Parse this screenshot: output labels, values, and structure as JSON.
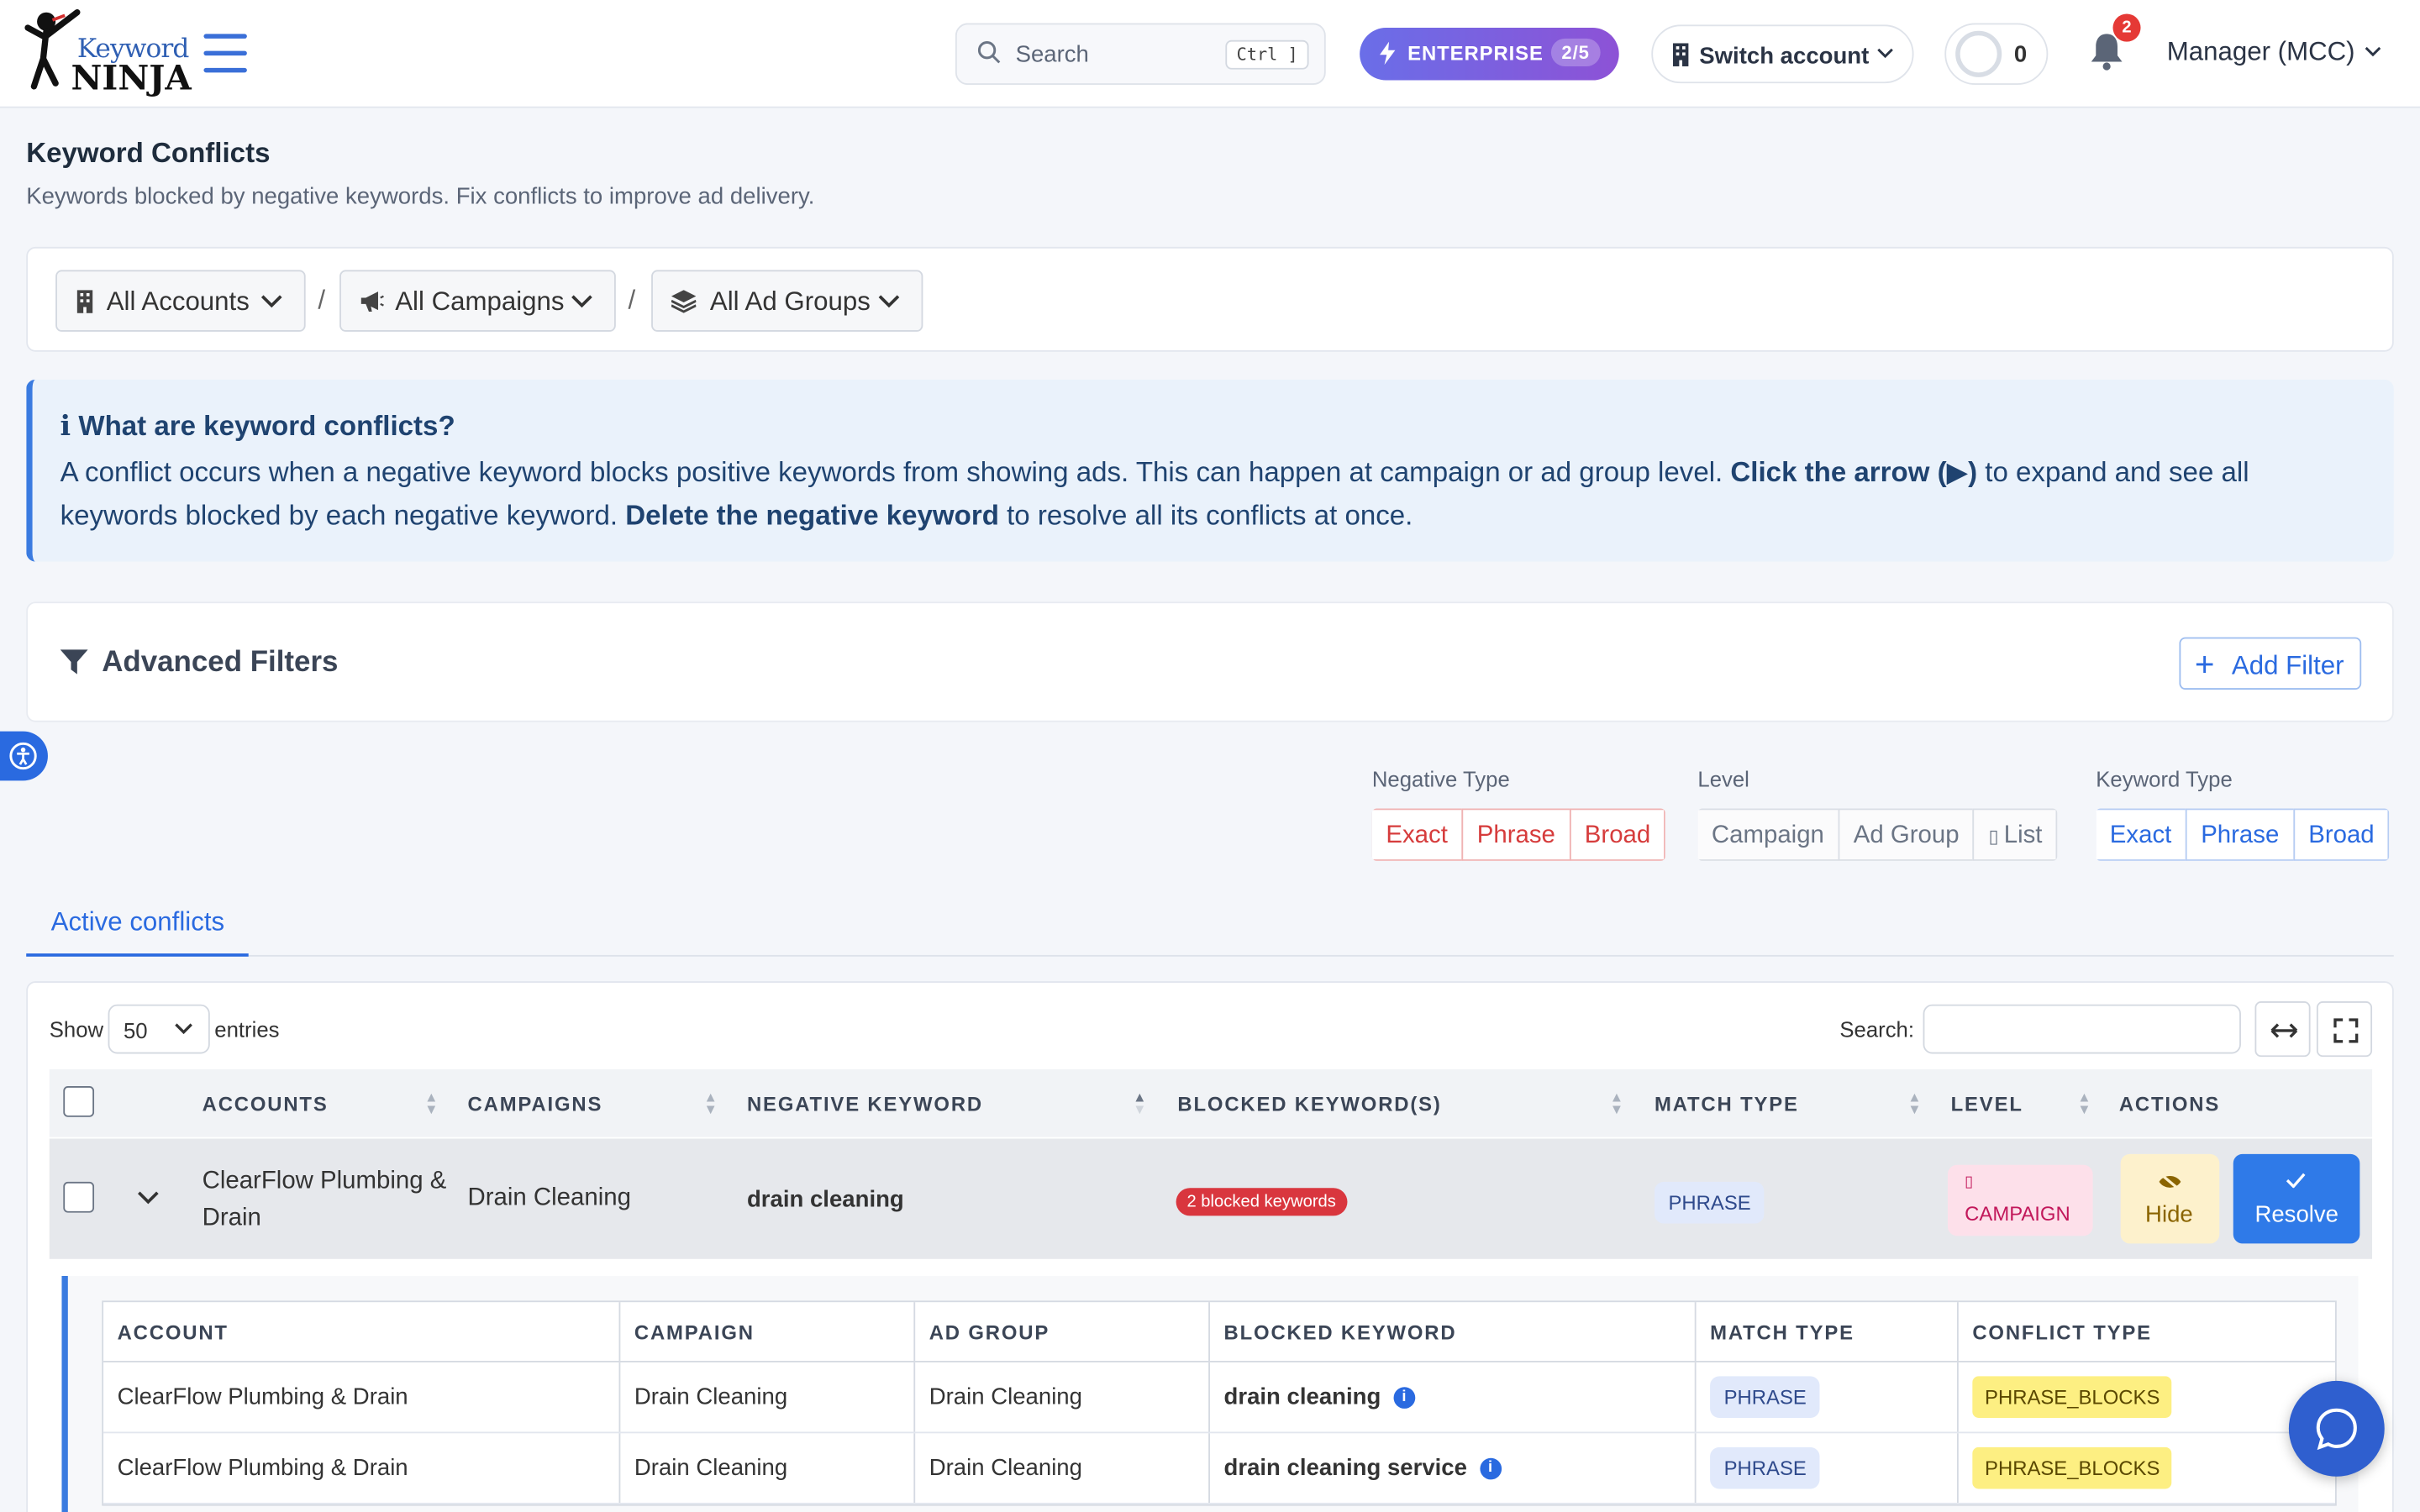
{
  "header": {
    "logo_top": "Keyword",
    "logo_bottom": "NINJA",
    "search_placeholder": "Search",
    "search_shortcut": "Ctrl ]",
    "plan_label": "ENTERPRISE",
    "plan_count": "2/5",
    "switch_account": "Switch account",
    "credits": "0",
    "notifications": "2",
    "user": "Manager (MCC)"
  },
  "page": {
    "title": "Keyword Conflicts",
    "subtitle": "Keywords blocked by negative keywords. Fix conflicts to improve ad delivery."
  },
  "selectors": {
    "accounts": "All Accounts",
    "campaigns": "All Campaigns",
    "ad_groups": "All Ad Groups",
    "separator": "/"
  },
  "info": {
    "heading": "ℹ What are keyword conflicts?",
    "text1": "A conflict occurs when a negative keyword blocks positive keywords from showing ads. This can happen at campaign or ad group level. ",
    "bold1": "Click the arrow (▶)",
    "text2": " to expand and see all keywords blocked by each negative keyword. ",
    "bold2": "Delete the negative keyword",
    "text3": " to resolve all its conflicts at once."
  },
  "filters": {
    "title": "Advanced Filters",
    "add": "Add Filter"
  },
  "toggles": {
    "negative_type_label": "Negative Type",
    "negative_type": [
      "Exact",
      "Phrase",
      "Broad"
    ],
    "level_label": "Level",
    "level": [
      "Campaign",
      "Ad Group",
      "List"
    ],
    "keyword_type_label": "Keyword Type",
    "keyword_type": [
      "Exact",
      "Phrase",
      "Broad"
    ]
  },
  "tabs": {
    "active": "Active conflicts"
  },
  "table": {
    "show": "Show",
    "page_size": "50",
    "entries": "entries",
    "search_label": "Search:",
    "columns": {
      "accounts": "ACCOUNTS",
      "campaigns": "CAMPAIGNS",
      "negative_keyword": "NEGATIVE KEYWORD",
      "blocked": "BLOCKED KEYWORD(S)",
      "match_type": "MATCH TYPE",
      "level": "LEVEL",
      "actions": "ACTIONS"
    },
    "row": {
      "account_line1": "ClearFlow Plumbing &",
      "account_line2": "Drain",
      "campaign": "Drain Cleaning",
      "negative_keyword": "drain cleaning",
      "blocked_badge": "2 blocked keywords",
      "match_type": "PHRASE",
      "level": "CAMPAIGN",
      "hide": "Hide",
      "resolve": "Resolve"
    }
  },
  "subtable": {
    "columns": [
      "ACCOUNT",
      "CAMPAIGN",
      "AD GROUP",
      "BLOCKED KEYWORD",
      "MATCH TYPE",
      "CONFLICT TYPE"
    ],
    "rows": [
      {
        "account": "ClearFlow Plumbing & Drain",
        "campaign": "Drain Cleaning",
        "ad_group": "Drain Cleaning",
        "keyword": "drain cleaning",
        "match": "PHRASE",
        "conflict": "PHRASE_BLOCKS"
      },
      {
        "account": "ClearFlow Plumbing & Drain",
        "campaign": "Drain Cleaning",
        "ad_group": "Drain Cleaning",
        "keyword": "drain cleaning service",
        "match": "PHRASE",
        "conflict": "PHRASE_BLOCKS"
      }
    ]
  },
  "colors": {
    "accent": "#2a6ae0",
    "danger": "#d9363e",
    "warning": "#fdef82"
  }
}
